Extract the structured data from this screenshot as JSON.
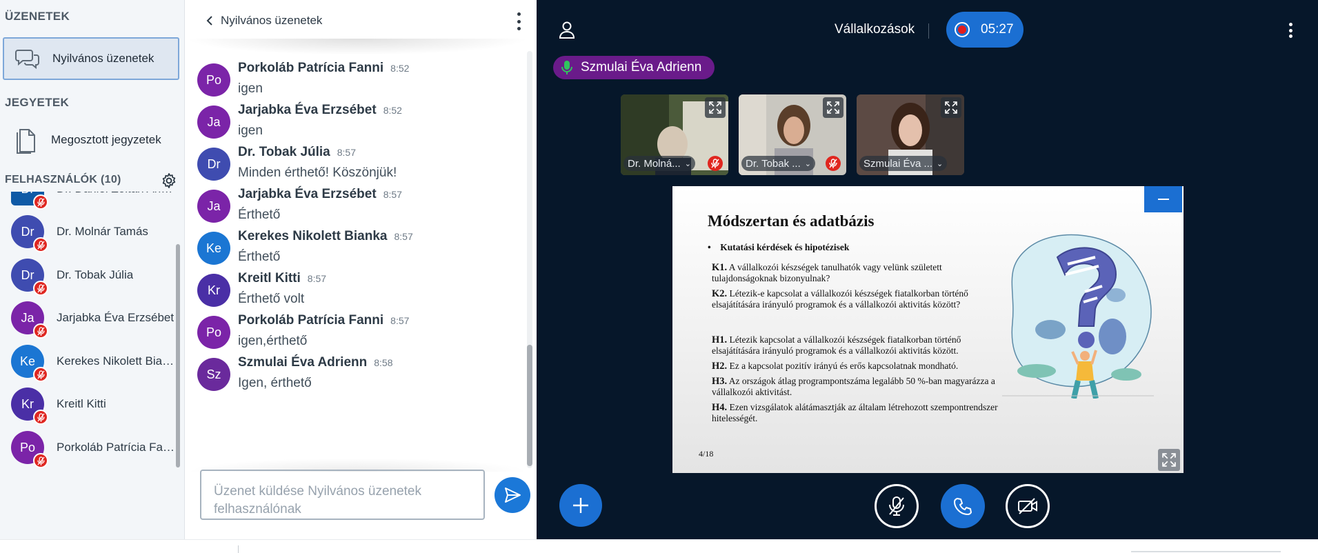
{
  "sidebar": {
    "messages_title": "ÜZENETEK",
    "public_chat_label": "Nyilvános üzenetek",
    "notes_title": "JEGYETEK",
    "shared_notes_label": "Megosztott jegyzetek",
    "users_title": "FELHASZNÁLÓK (10)",
    "users": [
      {
        "initials": "Dr",
        "name": "Dr. Dániel Zoltán András",
        "color": "#0f5aa6"
      },
      {
        "initials": "Dr",
        "name": "Dr. Molnár Tamás",
        "color": "#3f4cb0"
      },
      {
        "initials": "Dr",
        "name": "Dr. Tobak Júlia",
        "color": "#3f4cb0"
      },
      {
        "initials": "Ja",
        "name": "Jarjabka Éva Erzsébet",
        "color": "#7b24a8"
      },
      {
        "initials": "Ke",
        "name": "Kerekes Nikolett Bianka",
        "color": "#1b76d3"
      },
      {
        "initials": "Kr",
        "name": "Kreitl Kitti",
        "color": "#4a2fa6"
      },
      {
        "initials": "Po",
        "name": "Porkoláb Patrícia Fanni",
        "color": "#7b24a8"
      }
    ]
  },
  "chat": {
    "header_title": "Nyilvános üzenetek",
    "messages": [
      {
        "initials": "Po",
        "color": "#7b24a8",
        "name": "Porkoláb Patrícia Fanni",
        "time": "8:52",
        "text": "igen"
      },
      {
        "initials": "Ja",
        "color": "#7b24a8",
        "name": "Jarjabka Éva Erzsébet",
        "time": "8:52",
        "text": "igen"
      },
      {
        "initials": "Dr",
        "color": "#3f4cb0",
        "name": "Dr. Tobak Júlia",
        "time": "8:57",
        "text": "Minden érthető! Köszönjük!"
      },
      {
        "initials": "Ja",
        "color": "#7b24a8",
        "name": "Jarjabka Éva Erzsébet",
        "time": "8:57",
        "text": "Érthető"
      },
      {
        "initials": "Ke",
        "color": "#1b76d3",
        "name": "Kerekes Nikolett Bianka",
        "time": "8:57",
        "text": "Érthető"
      },
      {
        "initials": "Kr",
        "color": "#4a2fa6",
        "name": "Kreitl Kitti",
        "time": "8:57",
        "text": "Érthető volt"
      },
      {
        "initials": "Po",
        "color": "#7b24a8",
        "name": "Porkoláb Patrícia Fanni",
        "time": "8:57",
        "text": "igen,érthető"
      },
      {
        "initials": "Sz",
        "color": "#6a2a9c",
        "name": "Szmulai Éva Adrienn",
        "time": "8:58",
        "text": "Igen, érthető"
      }
    ],
    "input_placeholder": "Üzenet küldése Nyilvános üzenetek felhasználónak"
  },
  "stage": {
    "meeting_title": "Vállalkozások",
    "recording_time": "05:27",
    "talking_user": "Szmulai Éva Adrienn",
    "videos": [
      {
        "label": "Dr. Molná..."
      },
      {
        "label": "Dr. Tobak ..."
      },
      {
        "label": "Szmulai Éva ..."
      }
    ],
    "slide": {
      "title": "Módszertan és adatbázis",
      "bullet": "Kutatási kérdések és hipotézisek",
      "k1_tag": "K1.",
      "k1_text": "A vállalkozói készségek tanulhatók vagy velünk született tulajdonságoknak bizonyulnak?",
      "k2_tag": "K2.",
      "k2_text": "Létezik-e kapcsolat a vállalkozói készségek fiatalkorban történő elsajátítására irányuló programok és a vállalkozói aktivitás között?",
      "h1_tag": "H1.",
      "h1_text": "Létezik kapcsolat a vállalkozói készségek fiatalkorban történő elsajátítására irányuló programok és a vállalkozói aktivitás között.",
      "h2_tag": "H2.",
      "h2_text": "Ez a kapcsolat pozitív irányú és erős kapcsolatnak mondható.",
      "h3_tag": "H3.",
      "h3_text": "Az országok átlag programpontszáma legalább 50 %-ban magyarázza a vállalkozói aktivitást.",
      "h4_tag": "H4.",
      "h4_text": "Ezen vizsgálatok alátámasztják az általam létrehozott szempontrendszer hitelességét.",
      "page": "4/18"
    }
  },
  "colors": {
    "accent": "#1b6fd2",
    "stage_bg": "#06172a",
    "talking_bg": "#6a1b8a",
    "muted_red": "#df2721"
  }
}
